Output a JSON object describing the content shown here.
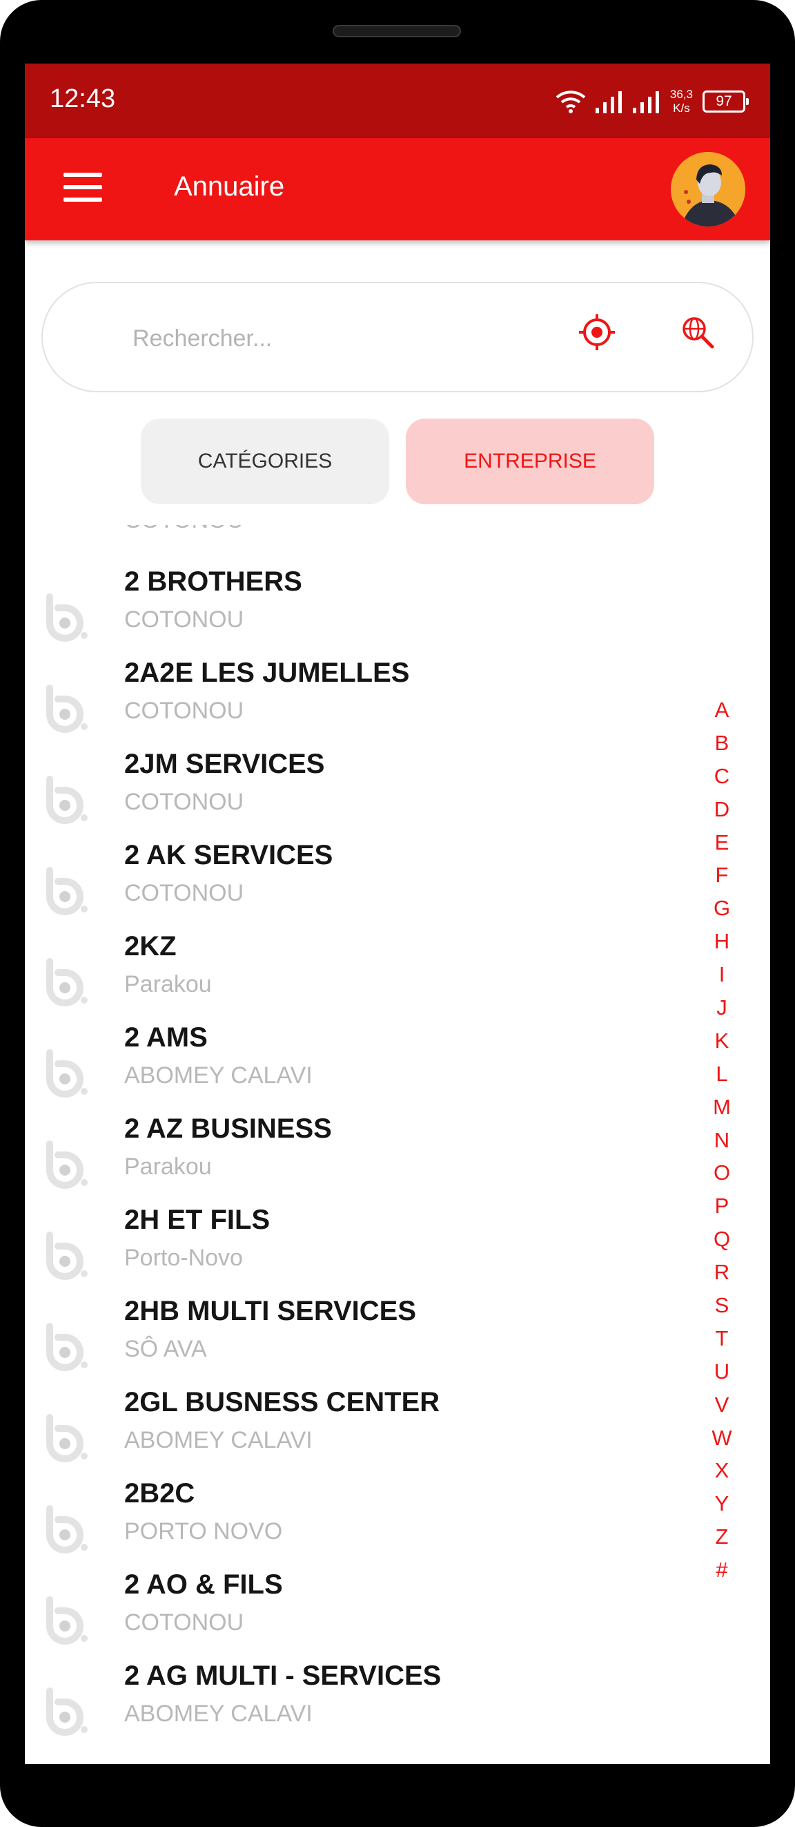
{
  "status_bar": {
    "time": "12:43",
    "speed_value": "36,3",
    "speed_unit": "K/s",
    "battery": "97"
  },
  "app_bar": {
    "title": "Annuaire"
  },
  "search": {
    "placeholder": "Rechercher..."
  },
  "tabs": [
    {
      "label": "CATÉGORIES",
      "active": false
    },
    {
      "label": "ENTREPRISE",
      "active": true
    }
  ],
  "list": {
    "cut_off_city": "COTONOU",
    "items": [
      {
        "name": "2 BROTHERS",
        "city": "COTONOU"
      },
      {
        "name": "2A2E LES JUMELLES",
        "city": "COTONOU"
      },
      {
        "name": "2JM SERVICES",
        "city": "COTONOU"
      },
      {
        "name": "2 AK SERVICES",
        "city": "COTONOU"
      },
      {
        "name": "2KZ",
        "city": "Parakou"
      },
      {
        "name": "2 AMS",
        "city": "ABOMEY CALAVI"
      },
      {
        "name": "2 AZ BUSINESS",
        "city": "Parakou"
      },
      {
        "name": "2H ET FILS",
        "city": "Porto-Novo"
      },
      {
        "name": "2HB MULTI SERVICES",
        "city": "SÔ AVA"
      },
      {
        "name": "2GL BUSNESS CENTER",
        "city": "ABOMEY CALAVI"
      },
      {
        "name": "2B2C",
        "city": "PORTO NOVO"
      },
      {
        "name": "2 AO & FILS",
        "city": "COTONOU"
      },
      {
        "name": "2 AG MULTI - SERVICES",
        "city": "ABOMEY CALAVI"
      }
    ]
  },
  "alphabet": [
    "A",
    "B",
    "C",
    "D",
    "E",
    "F",
    "G",
    "H",
    "I",
    "J",
    "K",
    "L",
    "M",
    "N",
    "O",
    "P",
    "Q",
    "R",
    "S",
    "T",
    "U",
    "V",
    "W",
    "X",
    "Y",
    "Z",
    "#"
  ],
  "colors": {
    "primary": "#ef1515",
    "status_bar": "#b10d0d",
    "tab_active_bg": "#fbcdcd",
    "tab_inactive_bg": "#f0f0f0"
  }
}
